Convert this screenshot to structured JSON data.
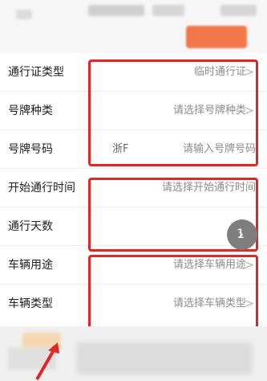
{
  "form": {
    "rows": [
      {
        "label": "通行证类型",
        "value": "临时通行证",
        "chevron": ">"
      },
      {
        "label": "号牌种类",
        "value": "请选择号牌种类",
        "chevron": ">"
      },
      {
        "label": "号牌号码",
        "prefix": "浙F",
        "value": "请输入号牌号码"
      },
      {
        "label": "开始通行时间",
        "value": "请选择开始通行时间"
      },
      {
        "label": "通行天数",
        "value": ""
      },
      {
        "label": "车辆用途",
        "value": "请选择车辆用途",
        "chevron": ">"
      },
      {
        "label": "车辆类型",
        "value": "请选择车辆类型",
        "chevron": ">"
      }
    ]
  },
  "floating_button": {
    "text": "1",
    "arrow": "›"
  },
  "colors": {
    "highlight": "#e12626",
    "accent": "#f26b3a",
    "arrow": "#e12626"
  }
}
